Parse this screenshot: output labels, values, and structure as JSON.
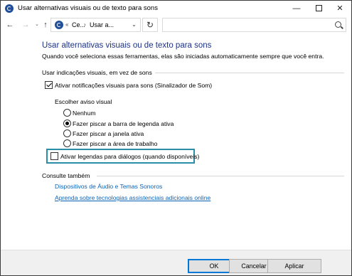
{
  "window": {
    "title": "Usar alternativas visuais ou de texto para sons",
    "minimize_glyph": "—",
    "close_glyph": "✕"
  },
  "navbar": {
    "back_glyph": "←",
    "forward_glyph": "→",
    "recent_glyph": "⌄",
    "up_glyph": "↑",
    "crumb_sep1": "«",
    "crumb1": "Ce...",
    "crumb_sep2": "›",
    "crumb2": "Usar a...",
    "dropdown_glyph": "⌄",
    "refresh_glyph": "↻",
    "search_placeholder": ""
  },
  "main": {
    "title": "Usar alternativas visuais ou de texto para sons",
    "description": "Quando você seleciona essas ferramentas, elas são iniciadas automaticamente sempre que você entra.",
    "visual_group": {
      "heading": "Usar indicações visuais, em vez de sons",
      "sound_sentry": {
        "label": "Ativar notificações visuais para sons (Sinalizador de Som)",
        "checked": true
      },
      "choose_heading": "Escolher aviso visual",
      "options": [
        {
          "label": "Nenhum",
          "selected": false
        },
        {
          "label": "Fazer piscar a barra de legenda ativa",
          "selected": true
        },
        {
          "label": "Fazer piscar a janela ativa",
          "selected": false
        },
        {
          "label": "Fazer piscar a área de trabalho",
          "selected": false
        }
      ],
      "captions": {
        "label": "Ativar legendas para diálogos (quando disponíveis)",
        "checked": false
      }
    },
    "see_also": {
      "heading": "Consulte também",
      "links": [
        "Dispositivos de Áudio e Temas Sonoros",
        "Aprenda sobre tecnologias assistenciais adicionais online"
      ]
    }
  },
  "footer": {
    "ok": "OK",
    "cancel": "Cancelar",
    "apply": "Aplicar"
  },
  "colors": {
    "title_blue": "#1e3287",
    "link_blue": "#0b63b8",
    "focus_teal": "#2a8fa6"
  }
}
